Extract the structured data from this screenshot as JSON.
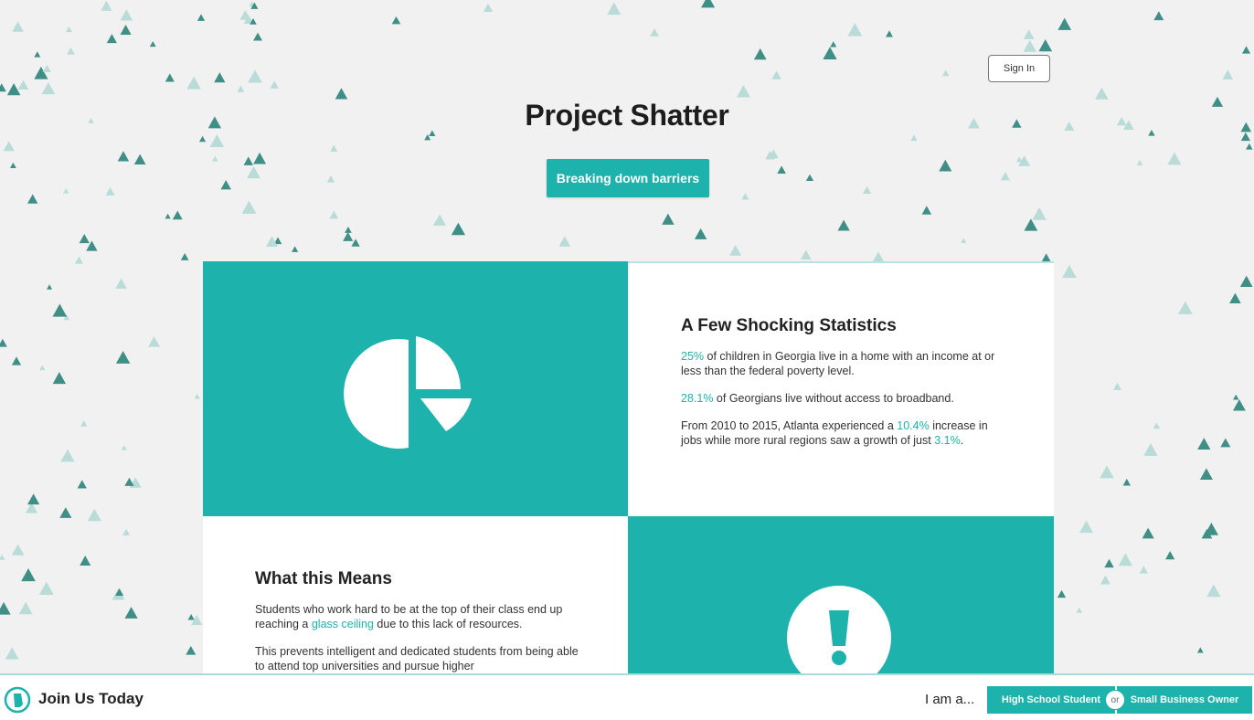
{
  "header": {
    "sign_in_label": "Sign In",
    "title": "Project Shatter",
    "tagline": "Breaking down barriers"
  },
  "icons": {
    "chart": "pie-chart-icon",
    "alert": "exclamation-icon",
    "logo": "georgia-logo-icon"
  },
  "stats": {
    "heading": "A Few Shocking Statistics",
    "items": [
      {
        "highlight": "25%",
        "text": " of children in Georgia live in a home with an income at or less than the federal poverty level."
      },
      {
        "highlight": "28.1%",
        "text": " of Georgians live without access to broadband."
      }
    ],
    "item3": {
      "pre": "From 2010 to 2015, Atlanta experienced a ",
      "highlight1": "10.4%",
      "mid": " increase in jobs while more rural regions saw a growth of just ",
      "highlight2": "3.1%",
      "post": "."
    }
  },
  "means": {
    "heading": "What this Means",
    "p1_pre": "Students who work hard to be at the top of their class end up reaching a ",
    "p1_highlight": "glass ceiling",
    "p1_post": " due to this lack of resources.",
    "p2": "This prevents intelligent and dedicated students from being able to attend top universities and pursue higher"
  },
  "footer": {
    "join": "Join Us Today",
    "iam": "I am a...",
    "option_high_school": "High School Student",
    "or": "or",
    "option_business": "Small Business Owner"
  },
  "colors": {
    "accent": "#1db3ac",
    "background": "#f1f1f1",
    "triangle_dark": "#3f8f87",
    "triangle_light": "#b9dcd8"
  }
}
